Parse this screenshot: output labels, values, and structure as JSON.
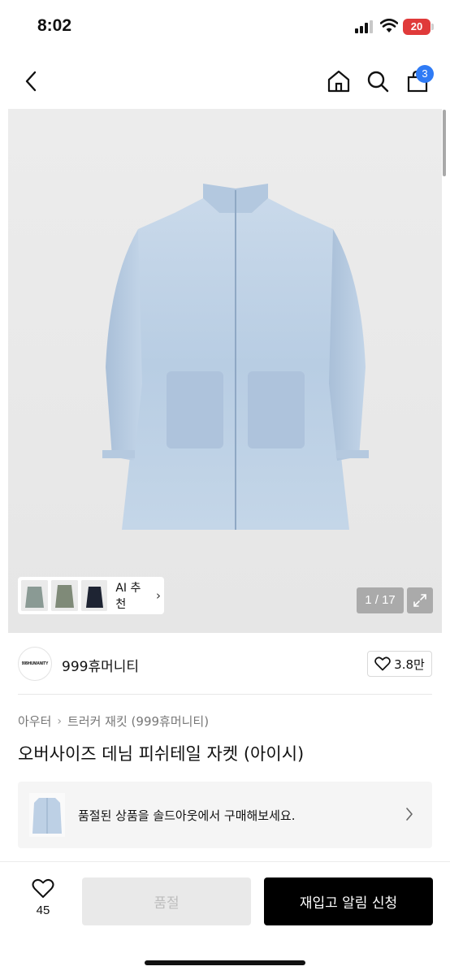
{
  "status_bar": {
    "time": "8:02",
    "battery": "20"
  },
  "nav": {
    "cart_count": "3",
    "icons": [
      "chevron-left-icon",
      "home-icon",
      "search-icon",
      "shopping-bag-icon"
    ]
  },
  "gallery": {
    "page_counter": "1 / 17",
    "ai_recommend_label": "AI 추천",
    "ai_chevron": "›"
  },
  "brand": {
    "logo_text": "999HUMANITY",
    "name": "999휴머니티",
    "likes": "3.8만"
  },
  "breadcrumb": [
    "아우터",
    "트러커 재킷 (999휴머니티)"
  ],
  "breadcrumb_separator": "›",
  "product": {
    "title": "오버사이즈 데님 피쉬테일 자켓 (아이시)"
  },
  "soldout_banner": {
    "text": "품절된 상품을 솔드아웃에서 구매해보세요."
  },
  "bottom_bar": {
    "wish_count": "45",
    "soldout_label": "품절",
    "restock_label": "재입고 알림 신청"
  },
  "colors": {
    "accent_badge": "#2f7bf5",
    "battery": "#e03a3a",
    "primary_button": "#000000"
  }
}
